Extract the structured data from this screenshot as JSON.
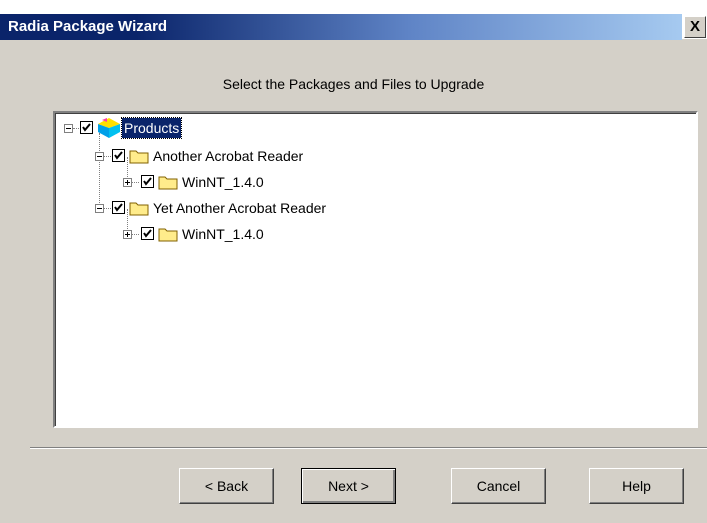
{
  "window": {
    "title": "Radia Package Wizard",
    "close_label": "X"
  },
  "heading": "Select the Packages and Files to Upgrade",
  "tree": {
    "root": {
      "label": "Products",
      "expanded": true,
      "checked": true
    },
    "packages": [
      {
        "label": "Another Acrobat Reader",
        "expanded": true,
        "checked": true,
        "children": [
          {
            "label": "WinNT_1.4.0",
            "expanded": false,
            "checked": true
          }
        ]
      },
      {
        "label": "Yet Another Acrobat Reader",
        "expanded": true,
        "checked": true,
        "children": [
          {
            "label": "WinNT_1.4.0",
            "expanded": false,
            "checked": true
          }
        ]
      }
    ]
  },
  "buttons": {
    "back": "< Back",
    "next": "Next >",
    "cancel": "Cancel",
    "help": "Help"
  }
}
